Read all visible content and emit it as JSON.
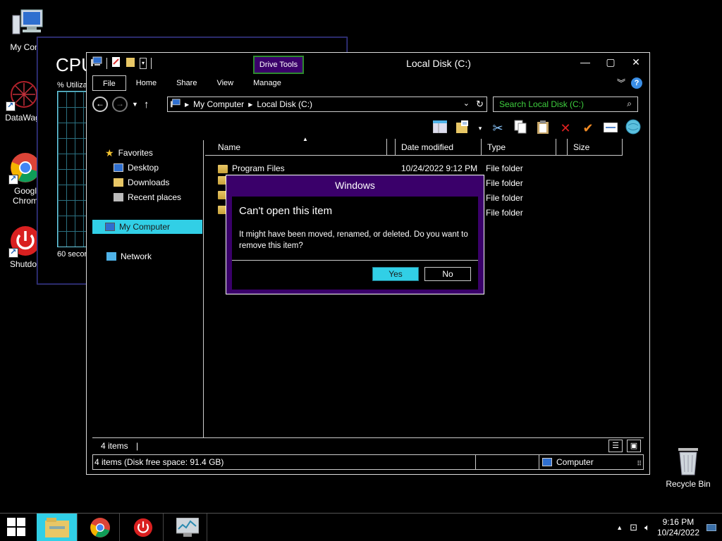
{
  "desktop": {
    "icons": [
      {
        "label": "My Comp",
        "icon": "computer-icon"
      },
      {
        "label": "DataWag",
        "icon": "datawagon-icon"
      },
      {
        "label": "Googl",
        "label2": "Chrom",
        "icon": "chrome-icon"
      },
      {
        "label": "Shutdov",
        "icon": "shutdown-icon"
      }
    ],
    "recycle_bin": "Recycle Bin"
  },
  "taskmgr": {
    "title": "CPU",
    "util_label": "% Utiliza",
    "seconds_label": "60 secor"
  },
  "explorer": {
    "title": "Local Disk (C:)",
    "context_tab": "Drive Tools",
    "tabs": [
      "File",
      "Home",
      "Share",
      "View",
      "Manage"
    ],
    "address": {
      "crumbs": [
        "My Computer",
        "Local Disk (C:)"
      ]
    },
    "search_placeholder": "Search Local Disk (C:)",
    "nav": {
      "favorites": "Favorites",
      "desktop": "Desktop",
      "downloads": "Downloads",
      "recent": "Recent places",
      "computer": "My Computer",
      "network": "Network"
    },
    "columns": [
      "Name",
      "Date modified",
      "Type",
      "Size"
    ],
    "files": [
      {
        "name": "Program Files",
        "date": "10/24/2022 9:12 PM",
        "type": "File folder"
      },
      {
        "name": "",
        "date": "",
        "type": "File folder"
      },
      {
        "name": "",
        "date": "",
        "type": "File folder"
      },
      {
        "name": "",
        "date": "",
        "type": "File folder"
      }
    ],
    "status_count": "4 items",
    "status_detail": "4 items (Disk free space: 91.4 GB)",
    "status_location": "Computer"
  },
  "dialog": {
    "title": "Windows",
    "heading": "Can't open this item",
    "message": "It might have been moved, renamed, or deleted. Do you want to remove this item?",
    "yes": "Yes",
    "no": "No"
  },
  "taskbar": {
    "time": "9:16 PM",
    "date": "10/24/2022"
  },
  "colors": {
    "accent": "#31cfe6",
    "dialog_title": "#3a006a",
    "search_text": "#3ecf3e"
  }
}
